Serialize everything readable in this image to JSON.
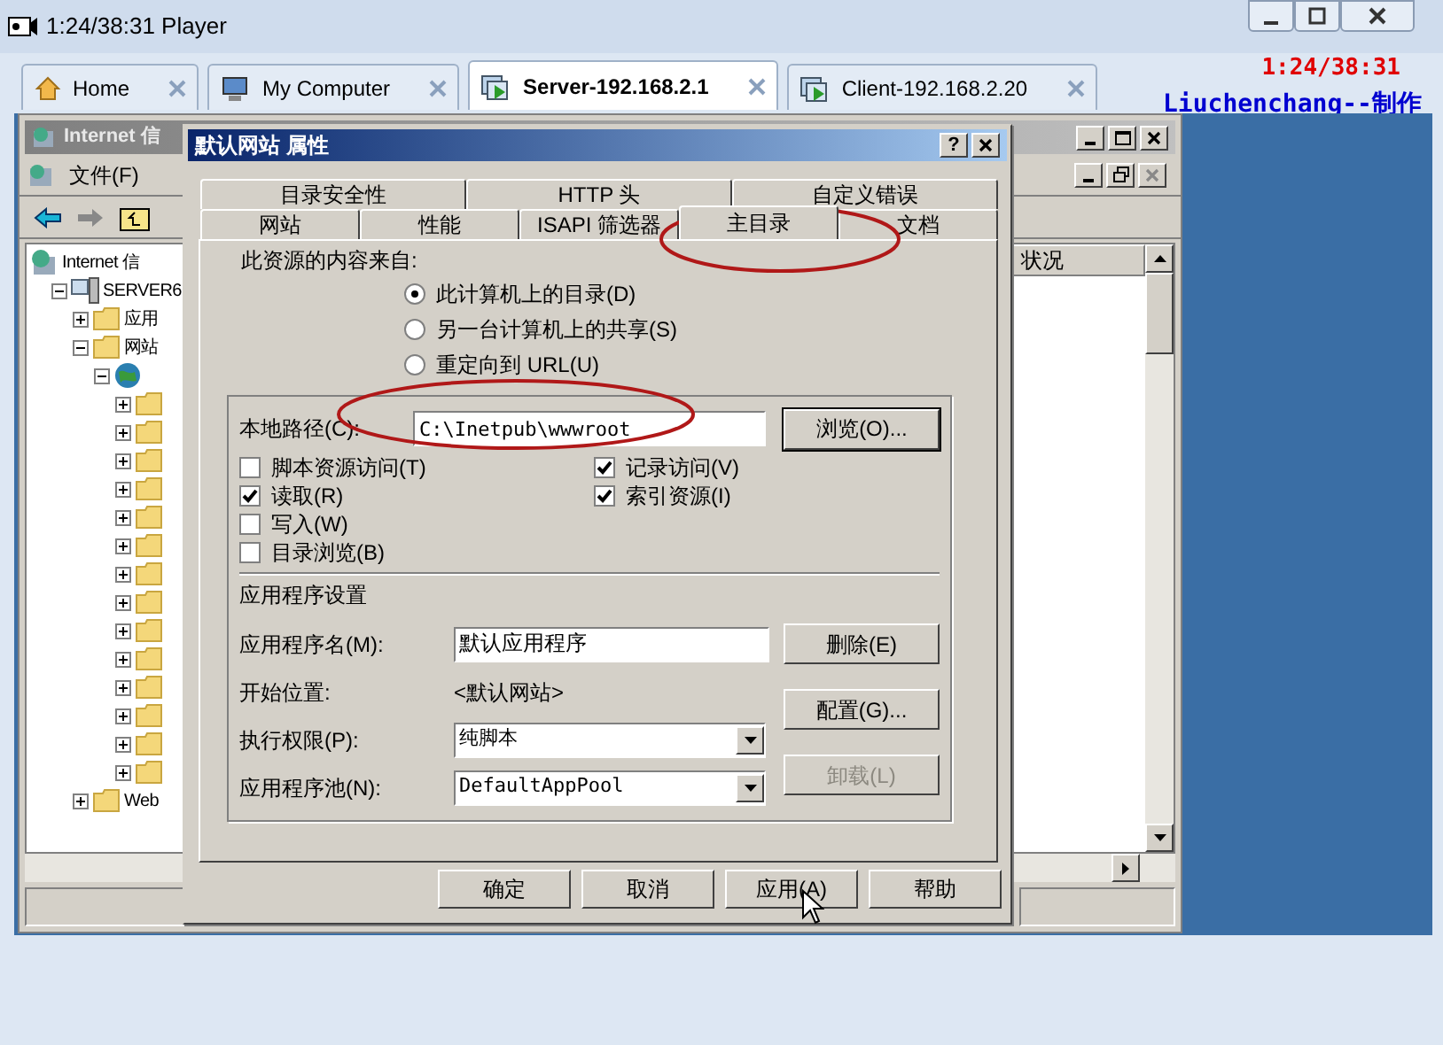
{
  "player": {
    "title": "1:24/38:31 Player"
  },
  "tabs": [
    {
      "label": "Home",
      "kind": "home",
      "selected": false
    },
    {
      "label": "My Computer",
      "kind": "computer",
      "selected": false
    },
    {
      "label": "Server-192.168.2.1",
      "kind": "vm",
      "selected": true
    },
    {
      "label": "Client-192.168.2.20",
      "kind": "vm",
      "selected": false
    }
  ],
  "recording_overlay": {
    "timestamp": "1:24/38:31",
    "credit": "Liuchenchang--制作"
  },
  "mmc": {
    "title": "Internet 信",
    "menu": [
      "文件(F)"
    ],
    "tree": [
      {
        "label": "Internet 信",
        "kind": "root",
        "children": [
          {
            "label": "SERVER6",
            "kind": "server",
            "expanded": true,
            "children": [
              {
                "label": "应用",
                "kind": "folder",
                "expanded": false
              },
              {
                "label": "网站",
                "kind": "folder",
                "expanded": true,
                "children": [
                  {
                    "kind": "site",
                    "expanded": true,
                    "children": [
                      {
                        "kind": "folder",
                        "expanded": false
                      },
                      {
                        "kind": "folder",
                        "expanded": false
                      },
                      {
                        "kind": "folder",
                        "expanded": false
                      },
                      {
                        "kind": "folder",
                        "expanded": false
                      },
                      {
                        "kind": "folder",
                        "expanded": false
                      },
                      {
                        "kind": "folder",
                        "expanded": false
                      },
                      {
                        "kind": "folder",
                        "expanded": false
                      },
                      {
                        "kind": "folder",
                        "expanded": false
                      },
                      {
                        "kind": "folder",
                        "expanded": false
                      },
                      {
                        "kind": "folder",
                        "expanded": false
                      },
                      {
                        "kind": "folder",
                        "expanded": false
                      },
                      {
                        "kind": "folder",
                        "expanded": false
                      },
                      {
                        "kind": "folder",
                        "expanded": false
                      },
                      {
                        "kind": "folder",
                        "expanded": false
                      }
                    ]
                  }
                ]
              },
              {
                "label": "Web",
                "kind": "folder",
                "expanded": false
              }
            ]
          }
        ]
      }
    ],
    "list_columns": [
      "状况"
    ]
  },
  "dialog": {
    "title": "默认网站 属性",
    "help": "?",
    "tab_rows": [
      [
        {
          "label": "目录安全性",
          "selected": false
        },
        {
          "label": "HTTP 头",
          "selected": false
        },
        {
          "label": "自定义错误",
          "selected": false
        }
      ],
      [
        {
          "label": "网站",
          "selected": false
        },
        {
          "label": "性能",
          "selected": false
        },
        {
          "label": "ISAPI 筛选器",
          "selected": false
        },
        {
          "label": "主目录",
          "selected": true
        },
        {
          "label": "文档",
          "selected": false
        }
      ]
    ],
    "source_label": "此资源的内容来自:",
    "sources": [
      {
        "label": "此计算机上的目录(D)",
        "selected": true
      },
      {
        "label": "另一台计算机上的共享(S)",
        "selected": false
      },
      {
        "label": "重定向到 URL(U)",
        "selected": false
      }
    ],
    "local_path": {
      "label": "本地路径(C):",
      "value": "C:\\Inetpub\\wwwroot",
      "button": "浏览(O)..."
    },
    "checkbox_columns": [
      [
        {
          "label": "脚本资源访问(T)",
          "checked": false
        },
        {
          "label": "读取(R)",
          "checked": true
        },
        {
          "label": "写入(W)",
          "checked": false
        },
        {
          "label": "目录浏览(B)",
          "checked": false
        }
      ],
      [
        {
          "label": "记录访问(V)",
          "checked": true
        },
        {
          "label": "索引资源(I)",
          "checked": true
        }
      ]
    ],
    "app_settings_title": "应用程序设置",
    "app_rows": [
      {
        "kind": "input",
        "label": "应用程序名(M):",
        "value": "默认应用程序"
      },
      {
        "kind": "text",
        "label": "开始位置:",
        "value": "<默认网站>"
      },
      {
        "kind": "select",
        "label": "执行权限(P):",
        "value": "纯脚本"
      },
      {
        "kind": "select",
        "label": "应用程序池(N):",
        "value": "DefaultAppPool"
      }
    ],
    "app_buttons": [
      {
        "label": "删除(E)",
        "disabled": false
      },
      {
        "label": "配置(G)...",
        "disabled": false
      },
      {
        "label": "卸载(L)",
        "disabled": true
      }
    ],
    "buttons": [
      {
        "label": "确定"
      },
      {
        "label": "取消"
      },
      {
        "label": "应用(A)"
      },
      {
        "label": "帮助"
      }
    ]
  }
}
